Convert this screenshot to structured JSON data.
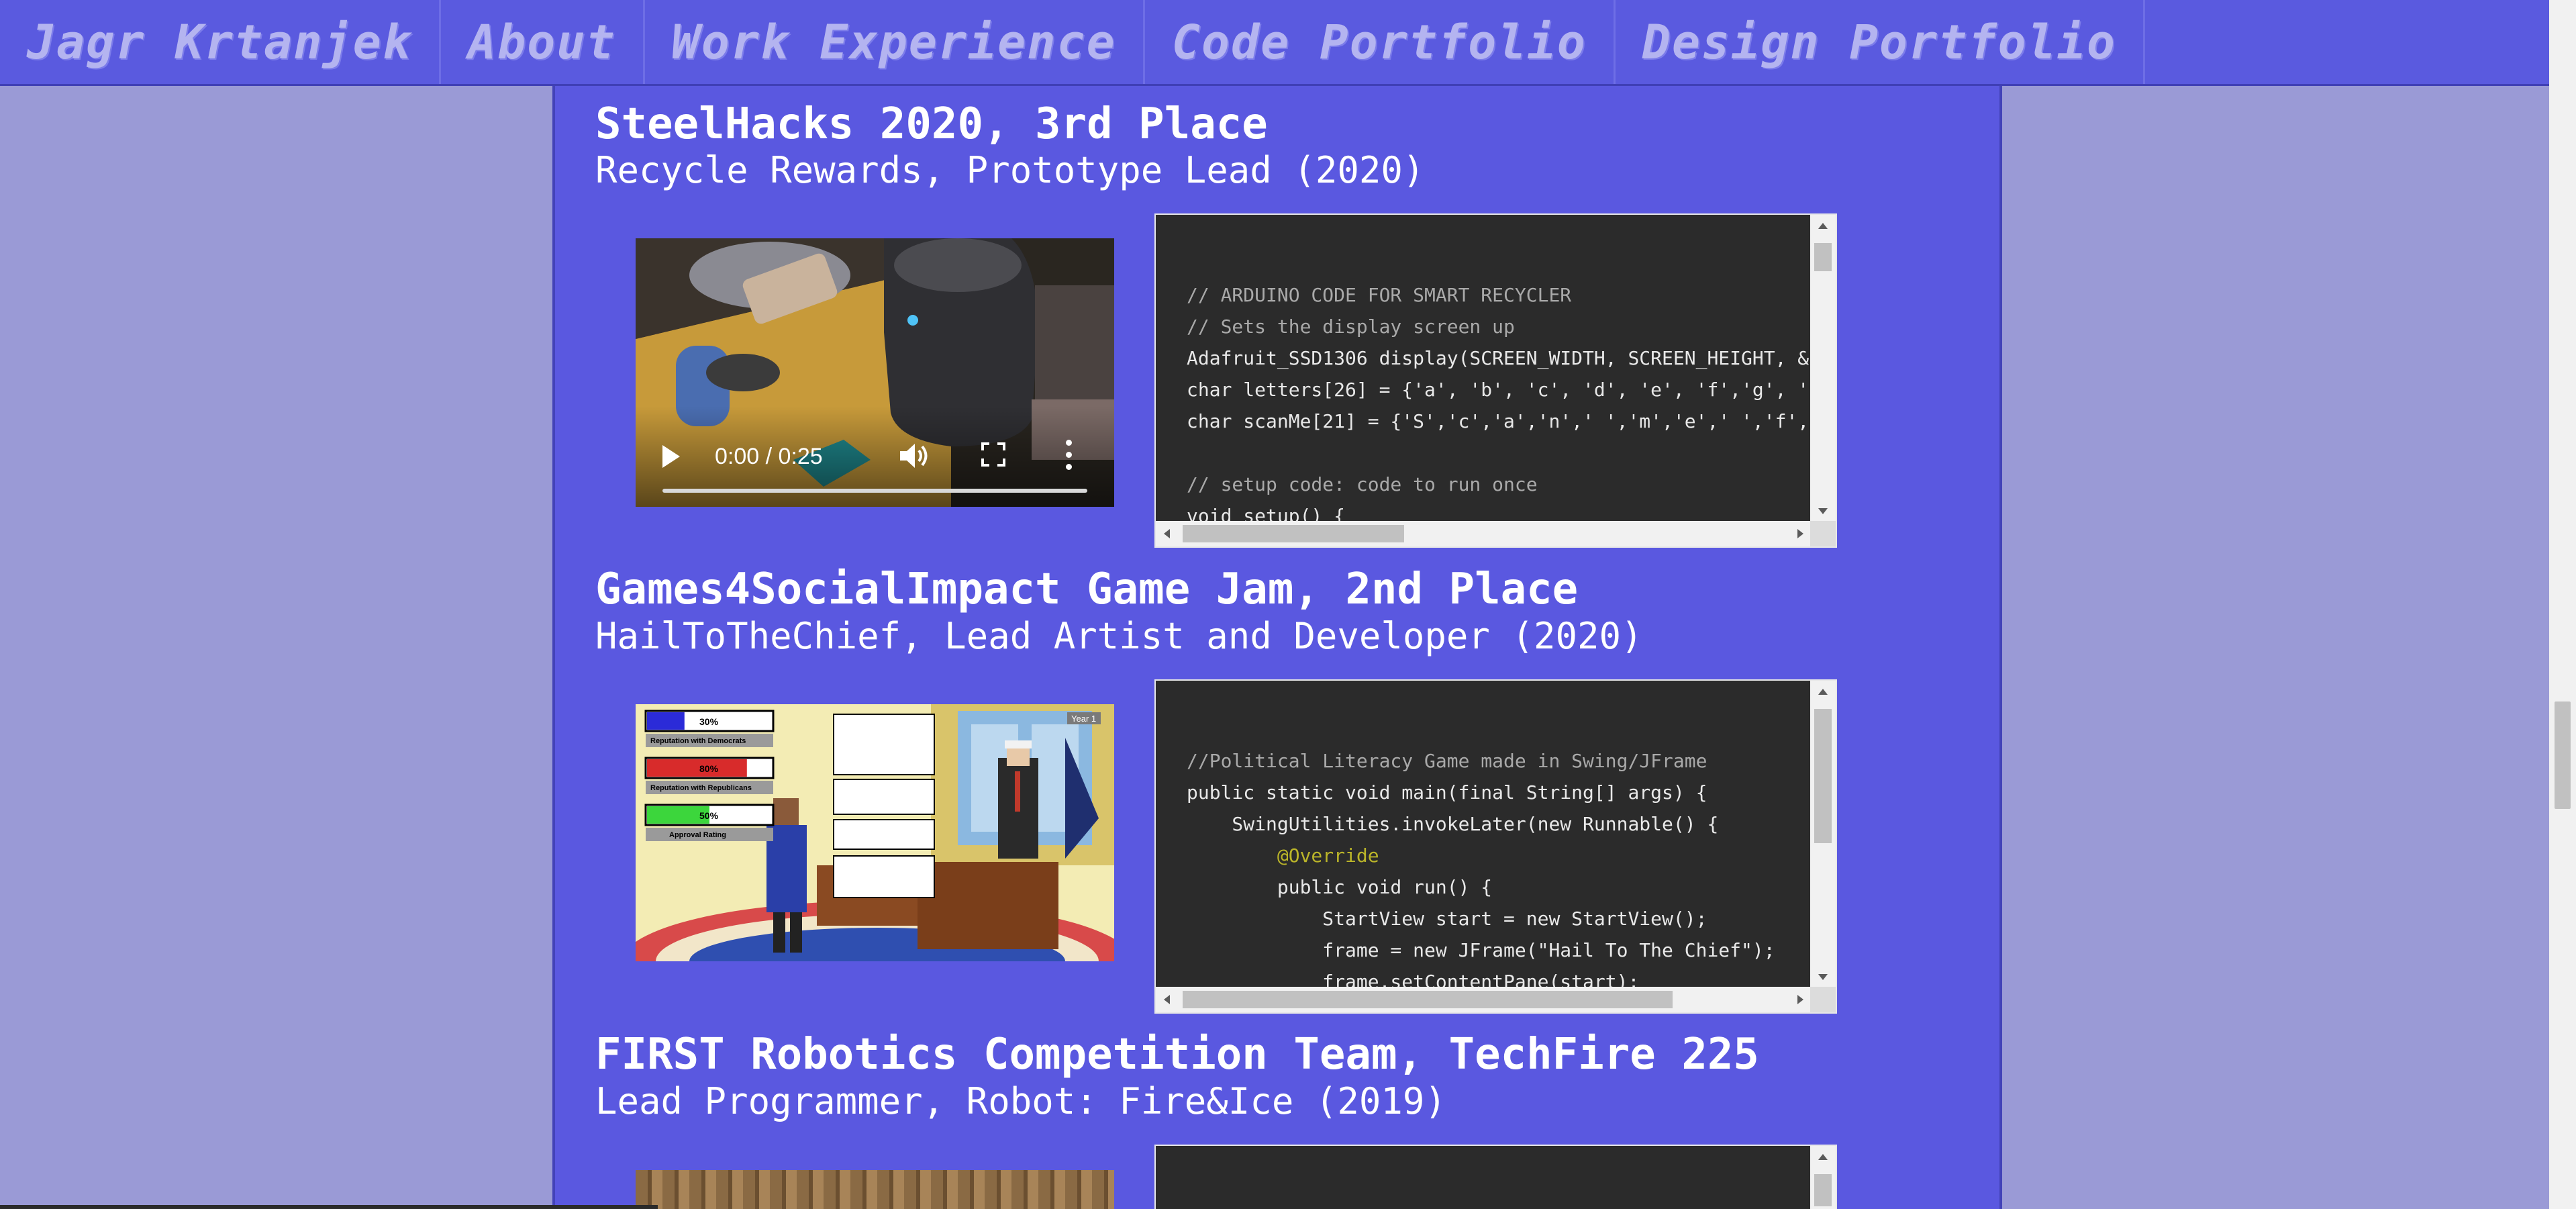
{
  "nav": {
    "items": [
      "Jagr Krtanjek",
      "About",
      "Work Experience",
      "Code Portfolio",
      "Design Portfolio"
    ]
  },
  "entries": [
    {
      "title": "SteelHacks 2020, 3rd Place",
      "subtitle": "Recycle Rewards, Prototype Lead (2020)",
      "media": {
        "type": "video",
        "time": "0:00 / 0:25"
      },
      "code_lines": [
        "// ARDUINO CODE FOR SMART RECYCLER",
        "// Sets the display screen up",
        "Adafruit_SSD1306 display(SCREEN_WIDTH, SCREEN_HEIGHT, &",
        "char letters[26] = {'a', 'b', 'c', 'd', 'e', 'f','g', '",
        "char scanMe[21] = {'S','c','a','n',' ','m','e',' ','f',",
        "",
        "// setup code: code to run once",
        "void setup() {"
      ]
    },
    {
      "title": "Games4SocialImpact Game Jam, 2nd Place",
      "subtitle": "HailToTheChief, Lead Artist and Developer (2020)",
      "media": {
        "type": "image",
        "bars": [
          {
            "percent": "30%",
            "label": "Reputation with Democrats",
            "color": "#2b2bd8",
            "fill": 0.3
          },
          {
            "percent": "80%",
            "label": "Reputation with Republicans",
            "color": "#d82b2b",
            "fill": 0.8
          },
          {
            "percent": "50%",
            "label": "Approval Rating",
            "color": "#3cd63c",
            "fill": 0.5
          }
        ],
        "year_label": "Year 1"
      },
      "code_lines": [
        "//Political Literacy Game made in Swing/JFrame",
        "public static void main(final String[] args) {",
        "    SwingUtilities.invokeLater(new Runnable() {",
        "        @Override",
        "        public void run() {",
        "            StartView start = new StartView();",
        "            frame = new JFrame(\"Hail To The Chief\");",
        "            frame.setContentPane(start);"
      ]
    },
    {
      "title": "FIRST Robotics Competition Team, TechFire 225",
      "subtitle": "Lead Programmer, Robot: Fire&Ice (2019)"
    }
  ]
}
